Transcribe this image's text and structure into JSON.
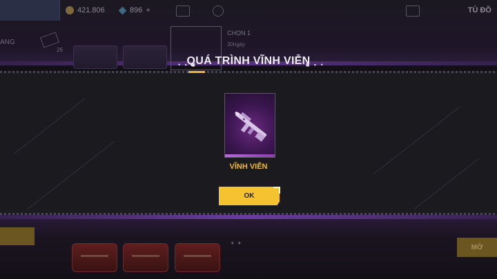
{
  "header": {
    "coins": "421.806",
    "diamonds": "896",
    "diamonds_plus": "+",
    "top_right_label": "TỦ ĐỒ"
  },
  "background": {
    "left_tab": "ANG",
    "left_count": "26",
    "choose_label": "CHỌN 1",
    "duration_label": "30ngày",
    "bottom_right_button": "MỞ"
  },
  "modal": {
    "title": "QUÁ TRÌNH VĨNH VIỄN",
    "title_decor_left": "• ▪ ■",
    "title_decor_right": "■ ▪ •",
    "item": {
      "icon": "assault-rifle-icon",
      "rarity_color": "#6a2a7e",
      "label": "VĨNH VIỄN"
    },
    "ok_button": "OK"
  },
  "colors": {
    "accent_yellow": "#f5c230",
    "label_gold": "#f2b83a",
    "purple_accent": "#7a46b5"
  }
}
